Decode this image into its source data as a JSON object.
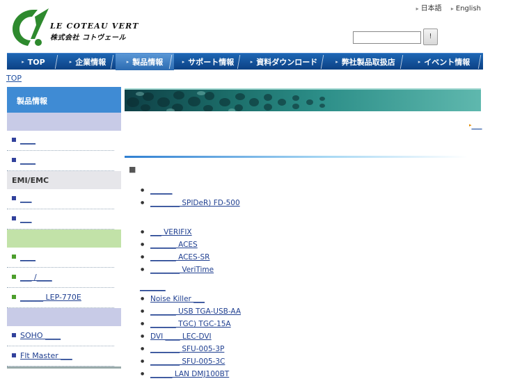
{
  "header": {
    "logo_en": "LE COTEAU VERT",
    "logo_jp": "株式会社 コトヴェール",
    "lang_links": [
      "日本語",
      "English"
    ],
    "search": {
      "value": "",
      "placeholder": "",
      "button_label": "!"
    }
  },
  "nav": {
    "items": [
      "TOP",
      "企業情報",
      "製品情報",
      "サポート情報",
      "資料ダウンロード",
      "弊社製品取扱店",
      "イベント情報"
    ],
    "active_index": 2
  },
  "breadcrumb": "TOP",
  "sidebar": {
    "heading": "製品情報",
    "group1_items": [
      "____",
      "____"
    ],
    "category_emi": "EMI/EMC",
    "group2_items": [
      "___",
      "___"
    ],
    "group3_items": [
      "____",
      "___ /____",
      "______ LEP-770E"
    ],
    "group4_items": [
      "SOHO ____",
      "Flt Master ___"
    ]
  },
  "main": {
    "top_link": "___",
    "section_marker": "■",
    "list1": [
      "______",
      "________ SPIDeR) FD-500"
    ],
    "list2": [
      "___ VERIFIX",
      "_______ ACES",
      "_______ ACES-SR",
      "________ VeriTime"
    ],
    "group_title": "_______",
    "list3": [
      "Noise Killer ___",
      "_______ USB TGA-USB-AA",
      "_______ TGC) TGC-15A",
      "DVI ____ LEC-DVI",
      "________ SFU-005-3P",
      "________ SFU-005-3C",
      "______ LAN DMJ100BT"
    ]
  },
  "colors": {
    "nav_bg": "#0c4184",
    "nav_active": "#2c6bb1",
    "sidebar_head": "#3f8bd4",
    "link": "#1f3f90",
    "logo_green": "#2e8a2e"
  }
}
